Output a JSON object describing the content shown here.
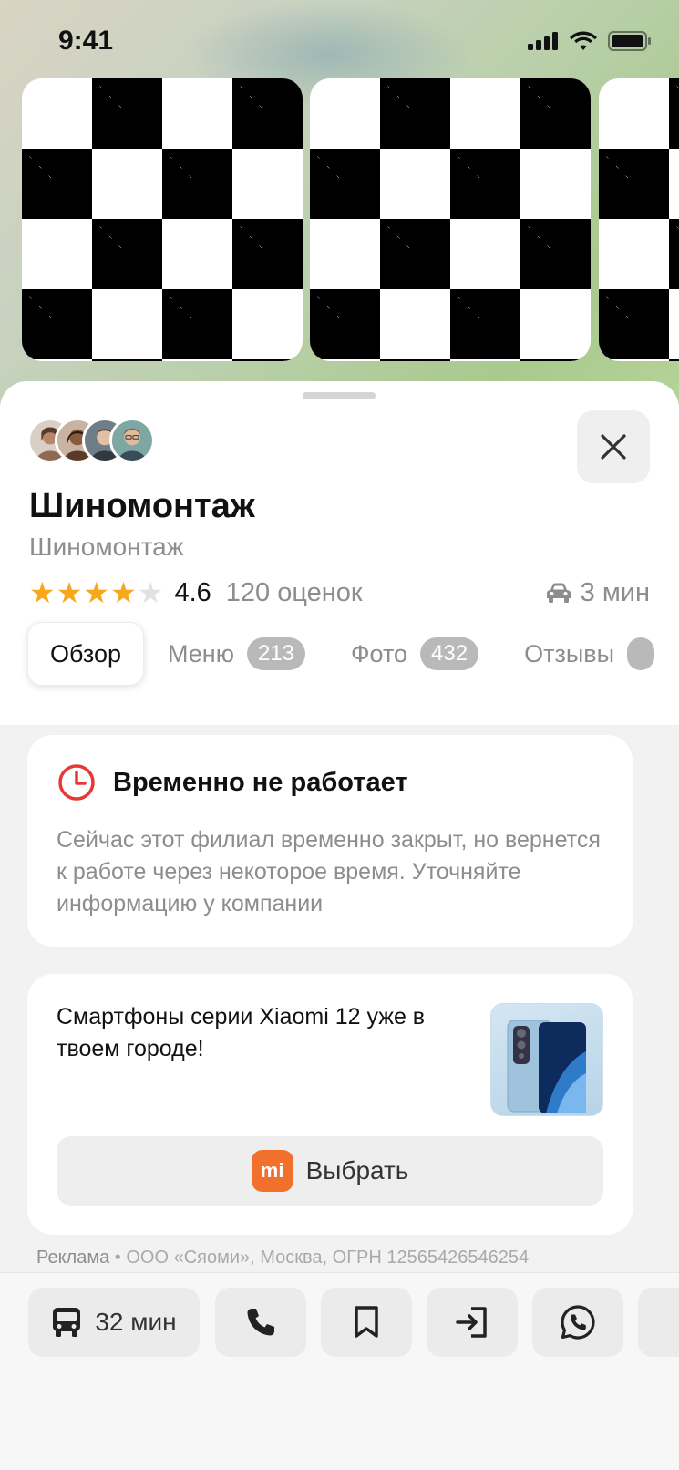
{
  "status_bar": {
    "time": "9:41"
  },
  "place": {
    "title": "Шиномонтаж",
    "category": "Шиномонтаж",
    "rating": {
      "stars_filled": 4,
      "stars_total": 5,
      "value": "4.6",
      "count_label": "120 оценок"
    },
    "drive_time": "3 мин"
  },
  "tabs": [
    {
      "label": "Обзор",
      "badge": "",
      "active": true
    },
    {
      "label": "Меню",
      "badge": "213",
      "active": false
    },
    {
      "label": "Фото",
      "badge": "432",
      "active": false
    },
    {
      "label": "Отзывы",
      "badge": "",
      "active": false
    }
  ],
  "closed_notice": {
    "title": "Временно не работает",
    "text": "Сейчас этот филиал временно закрыт, но вернется к работе через некоторое время. Уточняйте информацию у компании"
  },
  "ad": {
    "text": "Смартфоны серии Xiaomi 12 уже в твоем городе!",
    "button_label": "Выбрать",
    "logo_text": "mi",
    "disclaimer_label": "Реклама",
    "disclaimer_text": "• ООО «Сяоми», Москва, ОГРН 12565426546254"
  },
  "actions": {
    "transit_label": "32 мин",
    "icons": [
      "bus-icon",
      "phone-icon",
      "bookmark-icon",
      "route-icon",
      "whatsapp-icon"
    ]
  },
  "colors": {
    "star": "#f7a71c",
    "closed_icon": "#e53935",
    "xiaomi_orange": "#f0702c"
  }
}
